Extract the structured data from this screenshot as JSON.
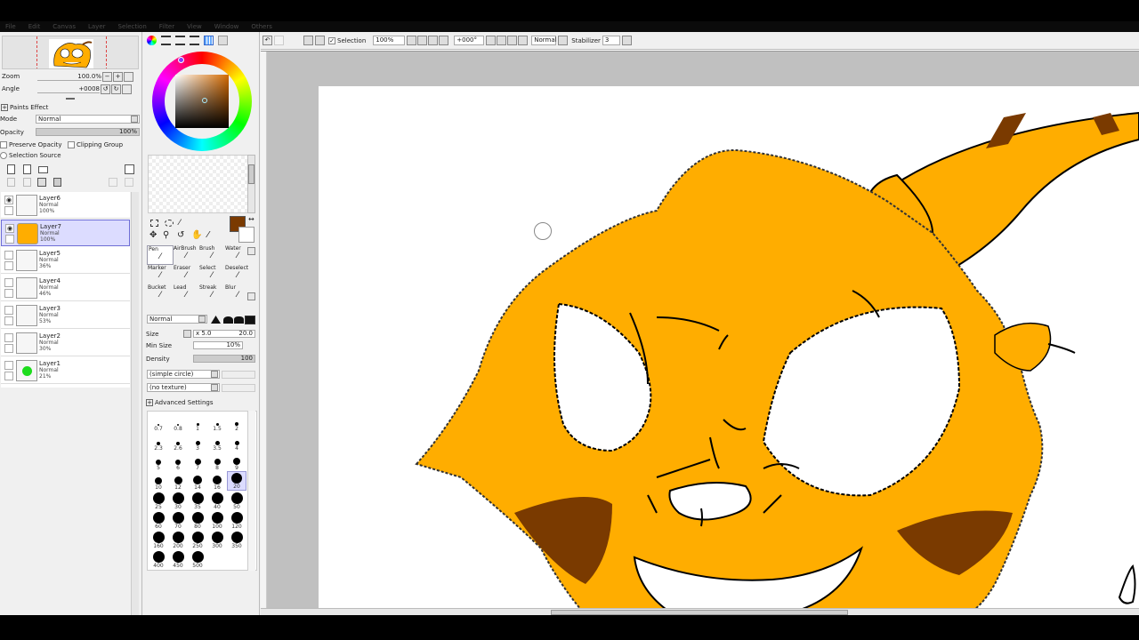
{
  "menu": [
    "File",
    "Edit",
    "Canvas",
    "Layer",
    "Selection",
    "Filter",
    "View",
    "Window",
    "Others"
  ],
  "navigator": {
    "zoom_label": "Zoom",
    "zoom_value": "100.0%",
    "angle_label": "Angle",
    "angle_value": "+0008"
  },
  "paints_effect": {
    "title": "Paints Effect",
    "mode_label": "Mode",
    "mode_value": "Normal",
    "opacity_label": "Opacity",
    "opacity_value": "100%",
    "preserve_opacity": "Preserve Opacity",
    "clipping_group": "Clipping Group",
    "selection_source": "Selection Source"
  },
  "layers": [
    {
      "name": "Layer6",
      "mode": "Normal",
      "opacity": "100%",
      "selected": false,
      "visible": true
    },
    {
      "name": "Layer7",
      "mode": "Normal",
      "opacity": "100%",
      "selected": true,
      "visible": true
    },
    {
      "name": "Layer5",
      "mode": "Normal",
      "opacity": "36%",
      "selected": false,
      "visible": false
    },
    {
      "name": "Layer4",
      "mode": "Normal",
      "opacity": "46%",
      "selected": false,
      "visible": false
    },
    {
      "name": "Layer3",
      "mode": "Normal",
      "opacity": "53%",
      "selected": false,
      "visible": false
    },
    {
      "name": "Layer2",
      "mode": "Normal",
      "opacity": "30%",
      "selected": false,
      "visible": false
    },
    {
      "name": "Layer1",
      "mode": "Normal",
      "opacity": "21%",
      "selected": false,
      "visible": false
    }
  ],
  "color": {
    "primary": "#7a3a00",
    "secondary": "#ffffff",
    "hue_accent": "#d46a00"
  },
  "brush_tools": [
    [
      "Pen",
      "AirBrush",
      "Brush",
      "Water"
    ],
    [
      "Marker",
      "Eraser",
      "Select",
      "Deselect"
    ],
    [
      "Bucket",
      "Lead",
      "Streak",
      "Blur"
    ]
  ],
  "selected_tool": "Pen",
  "brush_settings": {
    "blend_mode": "Normal",
    "size_label": "Size",
    "size_mult": "x 5.0",
    "size_value": "20.0",
    "minsize_label": "Min Size",
    "minsize_value": "10%",
    "density_label": "Density",
    "density_value": "100",
    "shape": "(simple circle)",
    "texture": "(no texture)",
    "advanced": "Advanced Settings"
  },
  "brush_sizes": [
    "0.7",
    "0.8",
    "1",
    "1.5",
    "2",
    "2.3",
    "2.6",
    "3",
    "3.5",
    "4",
    "5",
    "6",
    "7",
    "8",
    "9",
    "10",
    "12",
    "14",
    "16",
    "20",
    "25",
    "30",
    "35",
    "40",
    "50",
    "60",
    "70",
    "80",
    "100",
    "120",
    "160",
    "200",
    "250",
    "300",
    "350",
    "400",
    "450",
    "500"
  ],
  "selected_brush_size": "20",
  "canvas_toolbar": {
    "selection_label": "Selection",
    "zoom": "100%",
    "angle": "+000°",
    "blend": "Normal",
    "stabilizer_label": "Stabilizer",
    "stabilizer_value": "3"
  },
  "drawing": {
    "fur": "#ffad00",
    "stripe": "#7a3a00",
    "line": "#000000"
  }
}
